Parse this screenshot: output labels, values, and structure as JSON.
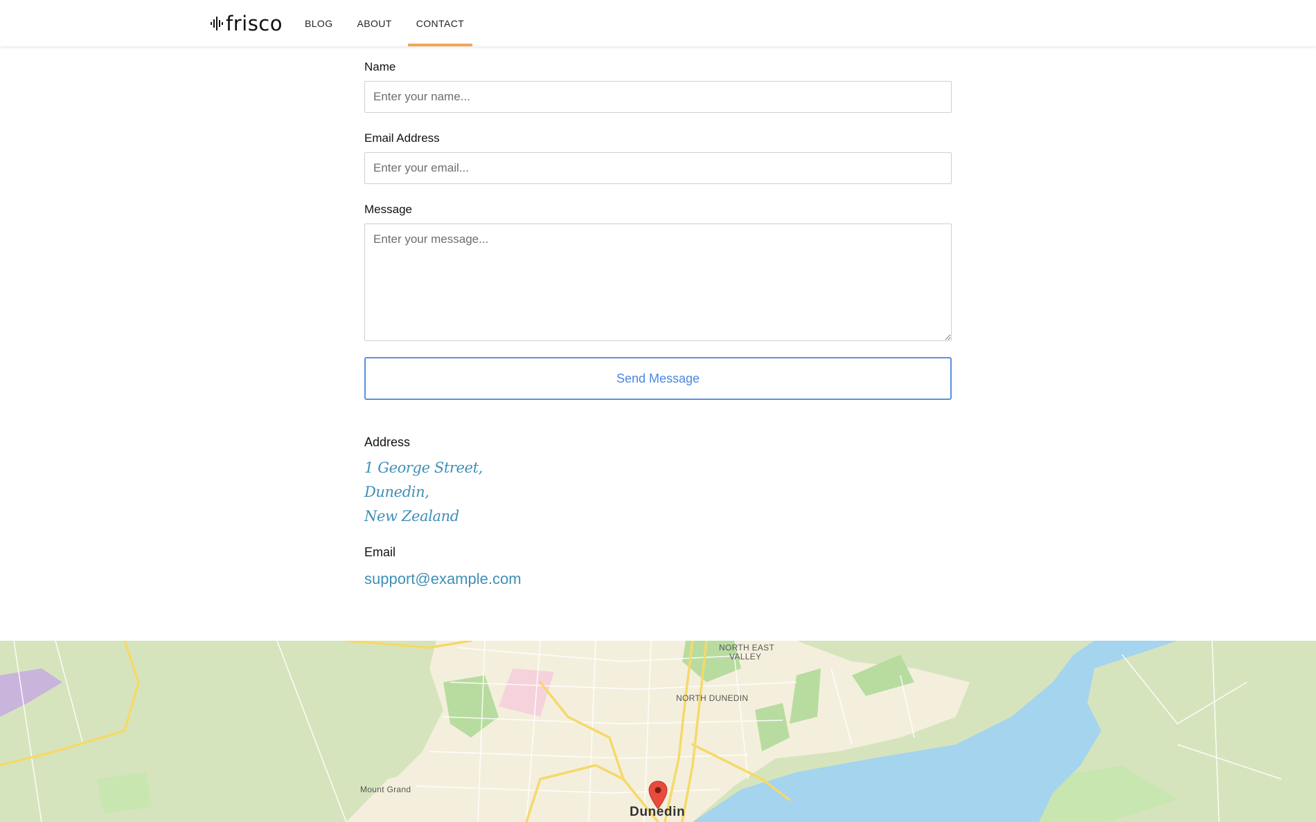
{
  "brand": {
    "name": "frisco",
    "accent": "#f0a65a"
  },
  "nav": {
    "items": [
      {
        "label": "BLOG"
      },
      {
        "label": "ABOUT"
      },
      {
        "label": "CONTACT",
        "active": true
      }
    ]
  },
  "form": {
    "name": {
      "label": "Name",
      "placeholder": "Enter your name..."
    },
    "email": {
      "label": "Email Address",
      "placeholder": "Enter your email..."
    },
    "message": {
      "label": "Message",
      "placeholder": "Enter your message..."
    },
    "submit_label": "Send Message",
    "button_color": "#4a86e0"
  },
  "contact": {
    "address_heading": "Address",
    "address_lines": [
      "1 George Street,",
      "Dunedin,",
      "New Zealand"
    ],
    "email_heading": "Email",
    "email": "support@example.com",
    "link_color": "#3f8fb8"
  },
  "map": {
    "labels": {
      "north_east_valley_1": "NORTH EAST",
      "north_east_valley_2": "VALLEY",
      "north_dunedin": "NORTH DUNEDIN",
      "mount_grand": "Mount Grand",
      "city": "Dunedin"
    },
    "colors": {
      "land": "#d6e4bd",
      "urban": "#f4efdc",
      "water": "#a4d4ee",
      "road": "#f5d96a",
      "park": "#b8dca0",
      "marker": "#e84b3c"
    },
    "marker_icon": "map-pin-icon"
  }
}
